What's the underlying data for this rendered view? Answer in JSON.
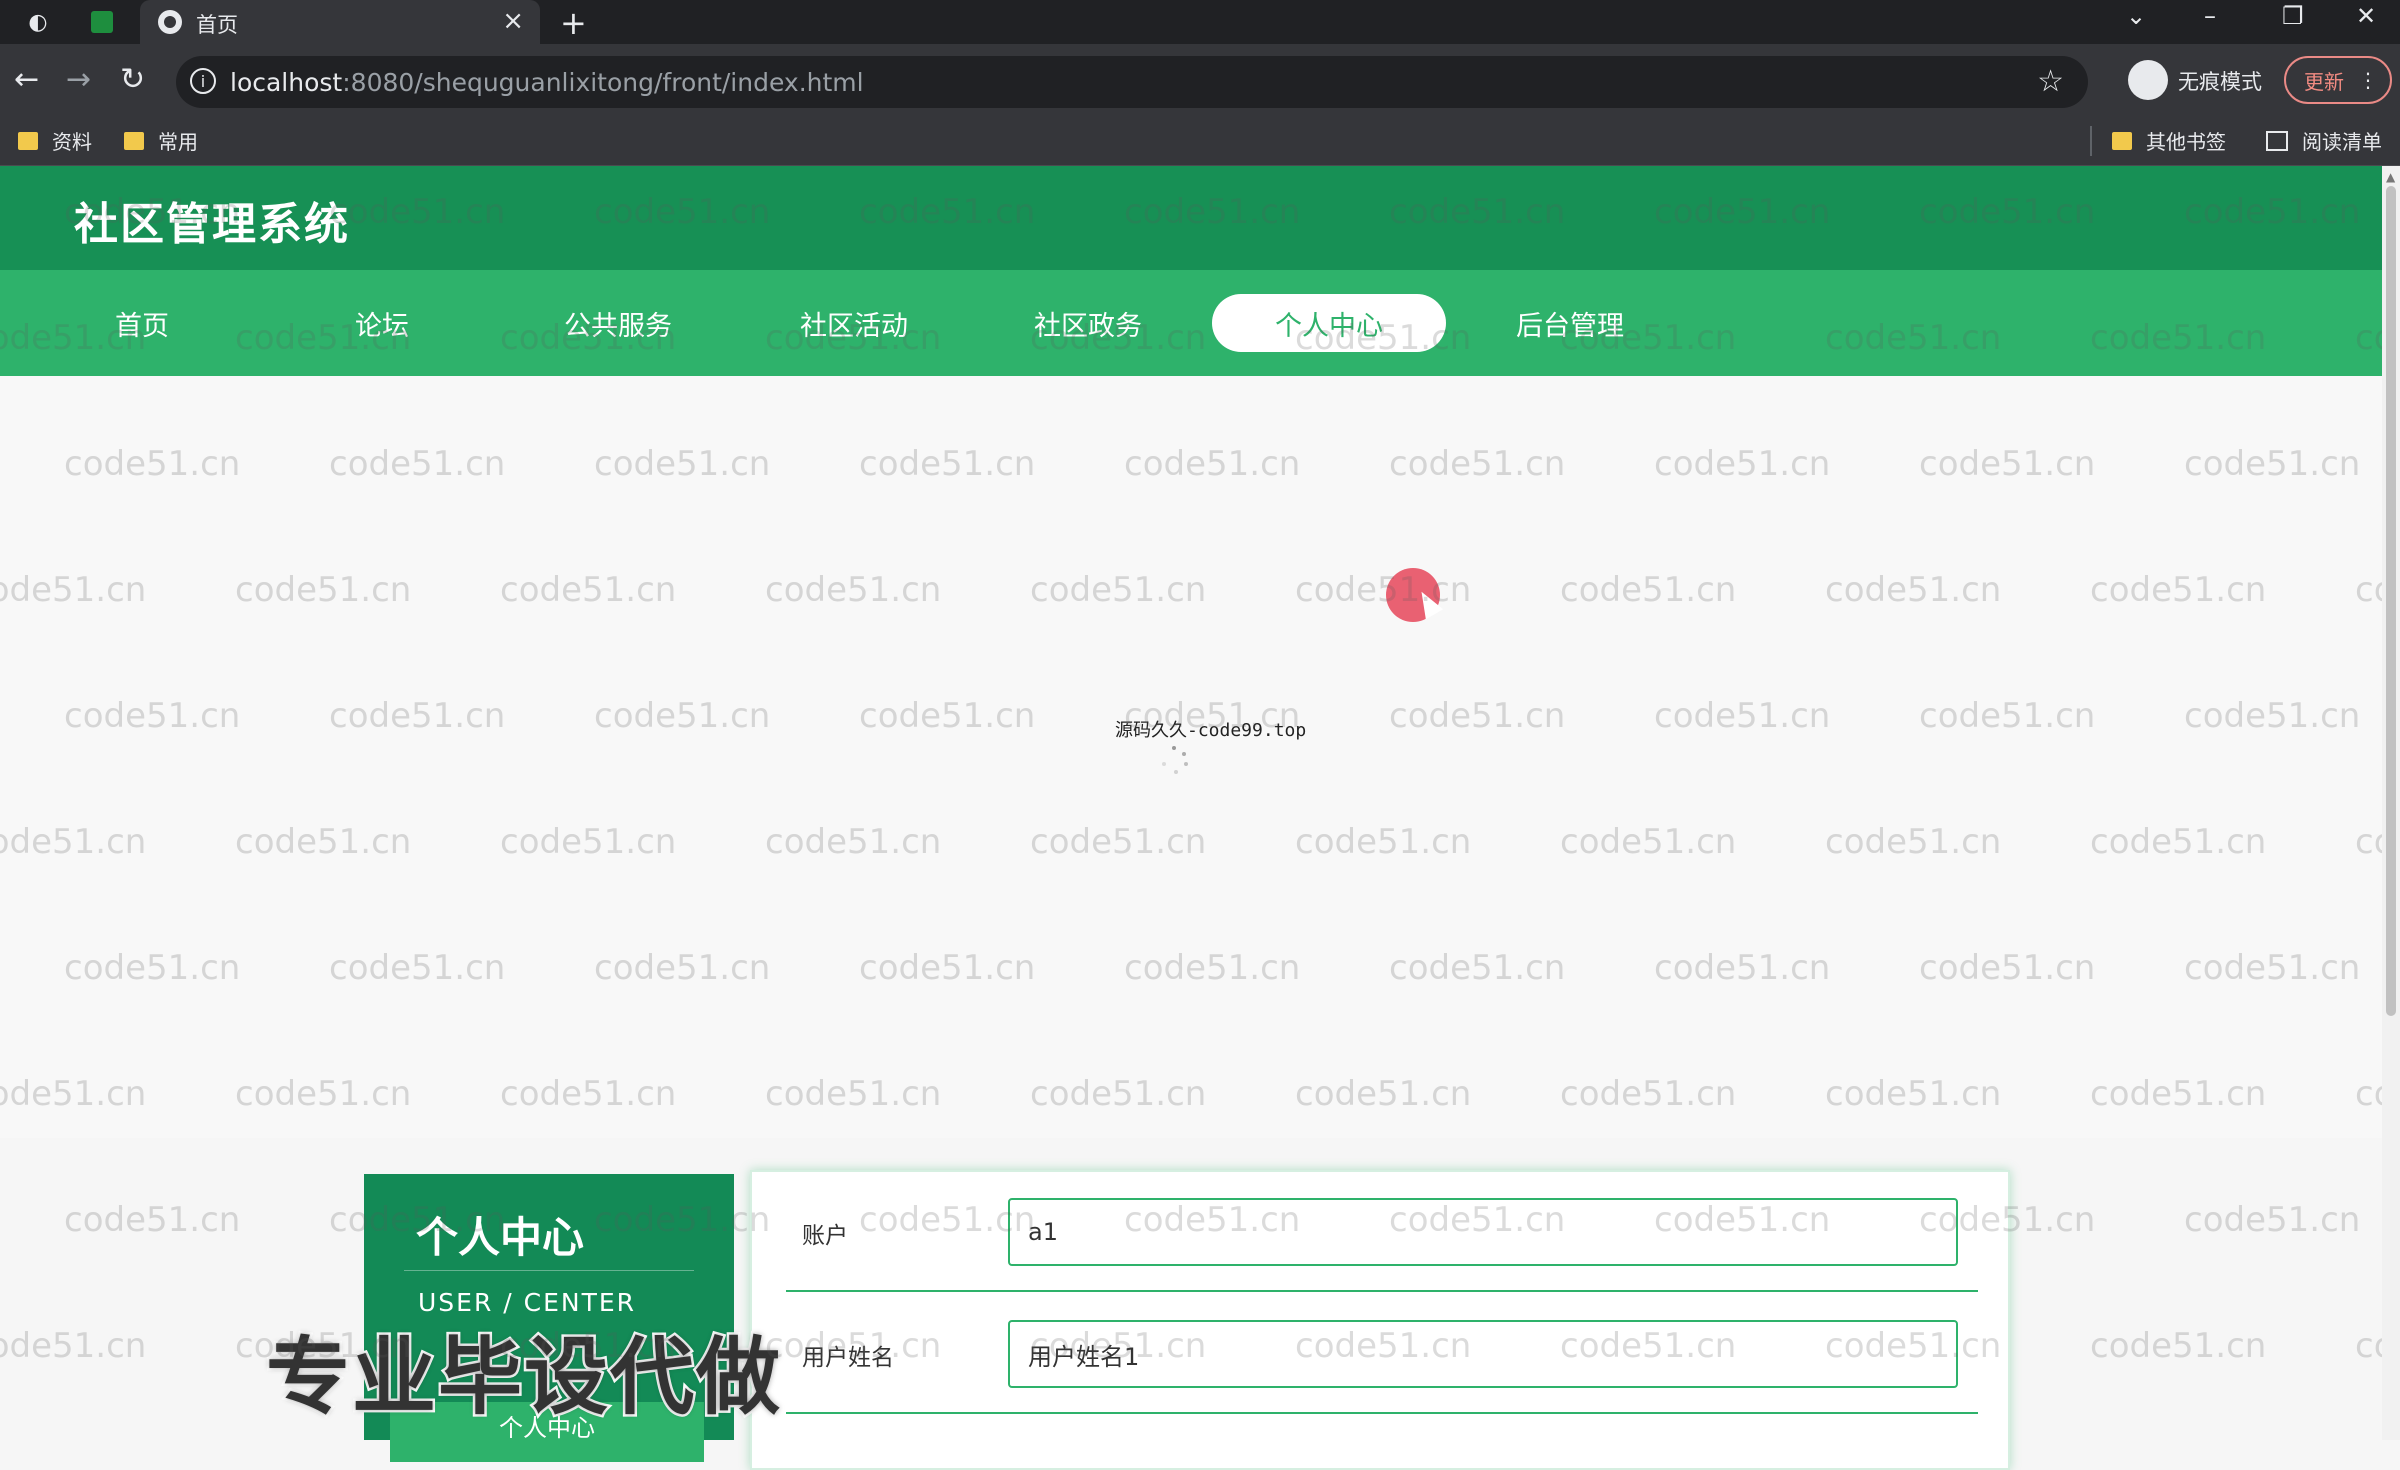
{
  "browser": {
    "tab_title": "首页",
    "url_host": "localhost",
    "url_rest": ":8080/shequguanlixitong/front/index.html",
    "incognito_label": "无痕模式",
    "update_label": "更新",
    "bookmarks": [
      "资料",
      "常用"
    ],
    "other_bookmarks": "其他书签",
    "reading_list": "阅读清单"
  },
  "site": {
    "title": "社区管理系统",
    "nav": [
      {
        "label": "首页",
        "active": false
      },
      {
        "label": "论坛",
        "active": false
      },
      {
        "label": "公共服务",
        "active": false
      },
      {
        "label": "社区活动",
        "active": false
      },
      {
        "label": "社区政务",
        "active": false
      },
      {
        "label": "个人中心",
        "active": true
      },
      {
        "label": "后台管理",
        "active": false
      }
    ]
  },
  "loading": {
    "text": "源码久久-code99.top"
  },
  "user_center": {
    "title": "个人中心",
    "subtitle": "USER / CENTER",
    "menu_item": "个人中心",
    "fields": [
      {
        "label": "账户",
        "value": "a1"
      },
      {
        "label": "用户姓名",
        "value": "用户姓名1"
      }
    ]
  },
  "overlay_text": "专业毕设代做",
  "watermark_text": "code51.cn",
  "colors": {
    "header_dark": "#179055",
    "nav_green": "#2eb26b",
    "sidebar_green": "#138a56"
  }
}
